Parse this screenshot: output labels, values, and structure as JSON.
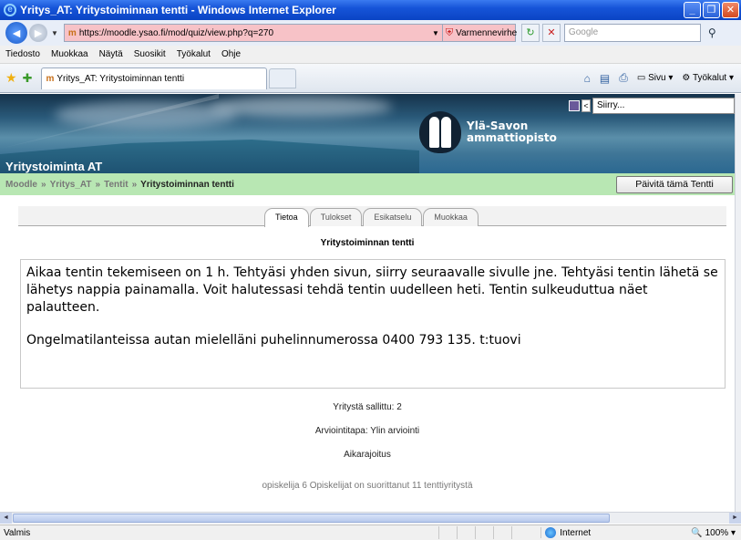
{
  "window": {
    "title": "Yritys_AT: Yritystoiminnan tentti - Windows Internet Explorer"
  },
  "address": {
    "url": "https://moodle.ysao.fi/mod/quiz/view.php?q=270",
    "cert_error": "Varmennevirhe",
    "search_placeholder": "Google"
  },
  "menu": [
    "Tiedosto",
    "Muokkaa",
    "Näytä",
    "Suosikit",
    "Työkalut",
    "Ohje"
  ],
  "browser_tab": {
    "title": "Yritys_AT: Yritystoiminnan tentti"
  },
  "command_bar": {
    "page": "Sivu",
    "tools": "Työkalut"
  },
  "banner": {
    "site_name": "Yritystoiminta AT",
    "logo_line1": "Ylä-Savon",
    "logo_line2": "ammattiopisto",
    "jump_placeholder": "Siirry..."
  },
  "breadcrumb": {
    "home": "Moodle",
    "course": "Yritys_AT",
    "section": "Tentit",
    "current": "Yritystoiminnan tentti",
    "separator": "»"
  },
  "update_button": "Päivitä tämä Tentti",
  "tabs": [
    "Tietoa",
    "Tulokset",
    "Esikatselu",
    "Muokkaa"
  ],
  "active_tab": "Tietoa",
  "quiz": {
    "title": "Yritystoiminnan tentti",
    "intro_p1": "Aikaa tentin tekemiseen on 1 h. Tehtyäsi yhden sivun, siirry seuraavalle sivulle jne. Tehtyäsi tentin lähetä se lähetys nappia painamalla. Voit halutessasi tehdä tentin uudelleen heti. Tentin sulkeuduttua näet palautteen.",
    "intro_p2": "Ongelmatilanteissa autan mielelläni puhelinnumerossa 0400 793 135. t:tuovi",
    "attempts_allowed": "Yritystä sallittu: 2",
    "grading_method": "Arviointitapa: Ylin arviointi",
    "time_limit": "Aikarajoitus",
    "summary": "opiskelija 6 Opiskelijat on suorittanut 11 tenttiyritystä"
  },
  "status": {
    "text": "Valmis",
    "zone": "Internet",
    "zoom": "100%"
  }
}
